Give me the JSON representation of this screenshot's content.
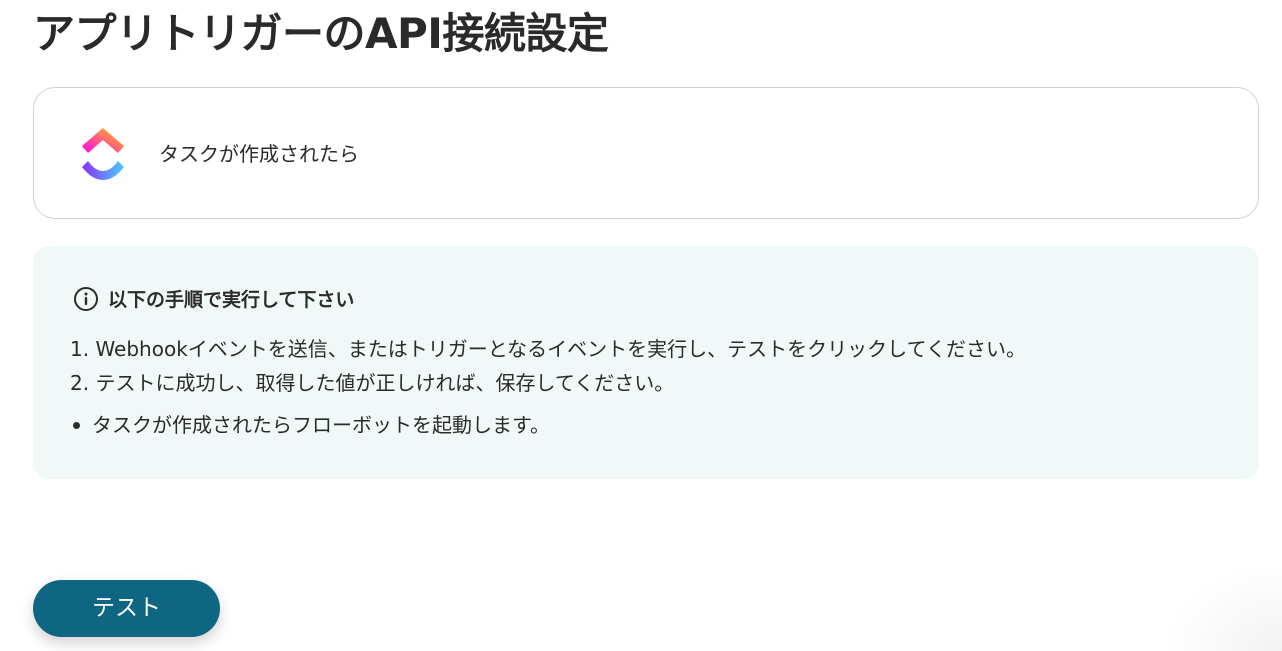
{
  "page": {
    "title": "アプリトリガーのAPI接続設定"
  },
  "trigger": {
    "app_icon": "clickup-logo-icon",
    "name": "タスクが作成されたら"
  },
  "instructions": {
    "icon": "info-icon",
    "heading": "以下の手順で実行して下さい",
    "steps": [
      "1. Webhookイベントを送信、またはトリガーとなるイベントを実行し、テストをクリックしてください。",
      "2. テストに成功し、取得した値が正しければ、保存してください。"
    ],
    "notes": [
      "タスクが作成されたらフローボットを起動します。"
    ]
  },
  "actions": {
    "test_label": "テスト"
  },
  "colors": {
    "primary_button": "#0e6683",
    "panel_background": "#f1f8f8",
    "card_border": "#cfd3d6",
    "text": "#2b2b2b"
  }
}
